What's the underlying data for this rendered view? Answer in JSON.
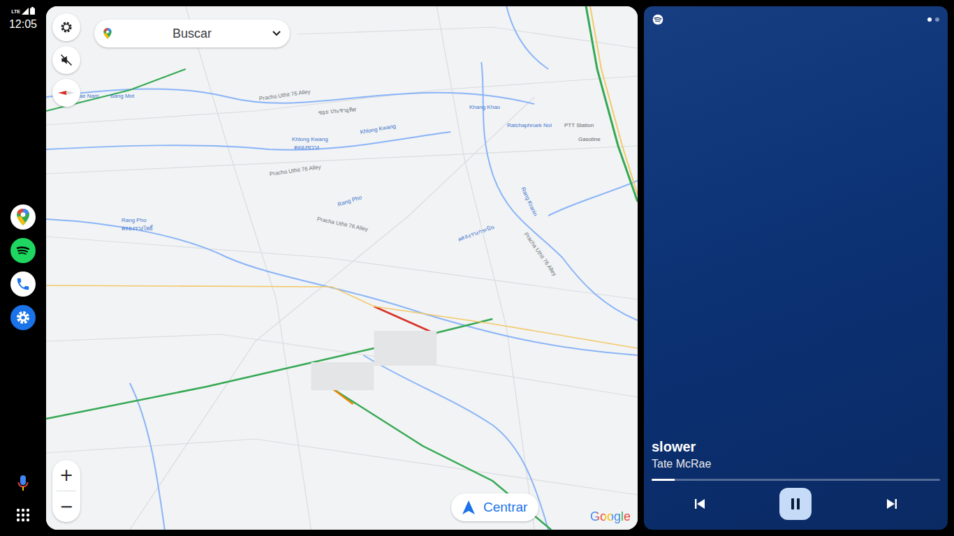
{
  "status_bar": {
    "network": "LTE",
    "time": "12:05"
  },
  "rail": {
    "apps": [
      {
        "kind": "maps"
      },
      {
        "kind": "spotify"
      },
      {
        "kind": "phone"
      },
      {
        "kind": "settings"
      }
    ]
  },
  "map": {
    "search": {
      "placeholder": "Buscar"
    },
    "sound_muted": true,
    "zoom_in": "+",
    "zoom_out": "−",
    "recenter": "Centrar",
    "attribution": "Google",
    "labels": [
      {
        "text": "Bang Mae Nam",
        "kind": "water"
      },
      {
        "text": "Bang Mot",
        "kind": "water"
      },
      {
        "text": "Pracha Uthit 76 Alley",
        "kind": "road"
      },
      {
        "text": "ซอย ประชาอุทิศ",
        "kind": "road"
      },
      {
        "text": "Khlong Kwang",
        "kind": "water"
      },
      {
        "text": "คลองขวาง",
        "kind": "water"
      },
      {
        "text": "Khlong Kwang",
        "kind": "water"
      },
      {
        "text": "Khang Khao",
        "kind": "water"
      },
      {
        "text": "Ratchaphruek Noi",
        "kind": "water"
      },
      {
        "text": "PTT Station",
        "kind": "poi"
      },
      {
        "text": "Gasoline",
        "kind": "poi"
      },
      {
        "text": "Pracha Uthit 76 Alley",
        "kind": "road"
      },
      {
        "text": "Rang Pho",
        "kind": "water"
      },
      {
        "text": "คลองรางโพธิ์",
        "kind": "water"
      },
      {
        "text": "Rang Pho",
        "kind": "water"
      },
      {
        "text": "Pracha Uthit 76 Alley",
        "kind": "road"
      },
      {
        "text": "Rang Kranin",
        "kind": "water"
      },
      {
        "text": "Pracha Uthit 76 Alley",
        "kind": "road"
      },
      {
        "text": "คลองรางกระนิน",
        "kind": "water"
      }
    ]
  },
  "media": {
    "title": "slower",
    "artist": "Tate McRae",
    "playing": true,
    "level": 0.08,
    "pages": [
      {
        "selected": true
      },
      {
        "selected": false
      }
    ]
  }
}
